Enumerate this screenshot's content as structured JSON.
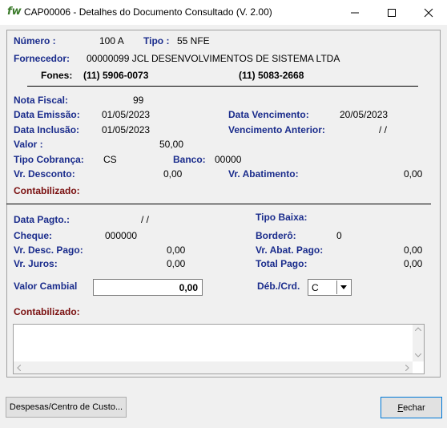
{
  "window": {
    "icon": "fw",
    "title": "CAP00006 - Detalhes do Documento Consultado    (V. 2.00)"
  },
  "header": {
    "numero_label": "Número :",
    "numero_value": "100 A",
    "tipo_label": "Tipo :",
    "tipo_value": "55  NFE",
    "fornecedor_label": "Fornecedor:",
    "fornecedor_value": "00000099  JCL DESENVOLVIMENTOS DE SISTEMA LTDA",
    "fones_label": "Fones:",
    "fone1": "(11)    5906-0073",
    "fone2": "(11)    5083-2668"
  },
  "doc": {
    "nota_label": "Nota Fiscal:",
    "nota_value": "99",
    "emissao_label": "Data Emissão:",
    "emissao_value": "01/05/2023",
    "vencimento_label": "Data Vencimento:",
    "vencimento_value": "20/05/2023",
    "inclusao_label": "Data Inclusão:",
    "inclusao_value": "01/05/2023",
    "venc_anterior_label": "Vencimento Anterior:",
    "venc_anterior_value": "/  /",
    "valor_label": "Valor :",
    "valor_value": "50,00",
    "tipo_cobranca_label": "Tipo Cobrança:",
    "tipo_cobranca_value": "CS",
    "banco_label": "Banco:",
    "banco_value": "00000",
    "desconto_label": "Vr. Desconto:",
    "desconto_value": "0,00",
    "abatimento_label": "Vr. Abatimento:",
    "abatimento_value": "0,00",
    "contabilizado_label": "Contabilizado:"
  },
  "payment": {
    "data_pagto_label": "Data Pagto.:",
    "data_pagto_value": "/  /",
    "tipo_baixa_label": "Tipo Baixa:",
    "cheque_label": "Cheque:",
    "cheque_value": "000000",
    "bordero_label": "Borderô:",
    "bordero_value": "0",
    "desc_pago_label": "Vr. Desc. Pago:",
    "desc_pago_value": "0,00",
    "abat_pago_label": "Vr. Abat. Pago:",
    "abat_pago_value": "0,00",
    "juros_label": "Vr. Juros:",
    "juros_value": "0,00",
    "total_pago_label": "Total Pago:",
    "total_pago_value": "0,00",
    "valor_cambial_label": "Valor Cambial",
    "valor_cambial_value": "0,00",
    "deb_crd_label": "Déb./Crd.",
    "deb_crd_value": "C",
    "contabilizado_label": "Contabilizado:"
  },
  "buttons": {
    "despesas": "Despesas/Centro de Custo...",
    "fechar_prefix": "F",
    "fechar_rest": "echar"
  },
  "icons": {
    "minimize": "minimize-icon",
    "maximize": "maximize-icon",
    "close": "close-icon"
  }
}
